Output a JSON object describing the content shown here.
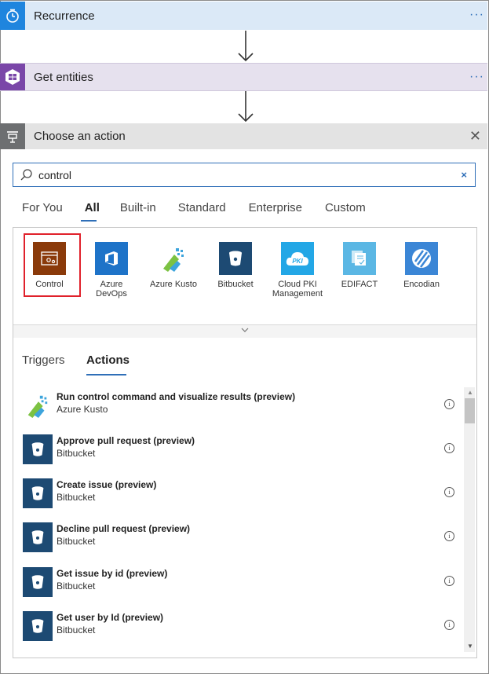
{
  "steps": {
    "recurrence": {
      "title": "Recurrence",
      "more": "···"
    },
    "get_entities": {
      "title": "Get entities",
      "more": "···"
    },
    "choose_action": {
      "title": "Choose an action",
      "close": "✕"
    }
  },
  "search": {
    "value": "control",
    "clear": "×"
  },
  "category_tabs": [
    "For You",
    "All",
    "Built-in",
    "Standard",
    "Enterprise",
    "Custom"
  ],
  "category_selected": "All",
  "connectors": [
    {
      "line1": "Control",
      "line2": "",
      "icon": "control-icon",
      "color": "#8a3a0a"
    },
    {
      "line1": "Azure",
      "line2": "DevOps",
      "icon": "azure-devops-icon",
      "color": "#1e73c8"
    },
    {
      "line1": "Azure Kusto",
      "line2": "",
      "icon": "azure-kusto-icon",
      "color": "#ffffff"
    },
    {
      "line1": "Bitbucket",
      "line2": "",
      "icon": "bitbucket-icon",
      "color": "#1d4a73"
    },
    {
      "line1": "Cloud PKI",
      "line2": "Management",
      "icon": "cloud-pki-icon",
      "color": "#23a7e6"
    },
    {
      "line1": "EDIFACT",
      "line2": "",
      "icon": "edifact-icon",
      "color": "#5bb7e4"
    },
    {
      "line1": "Encodian",
      "line2": "",
      "icon": "encodian-icon",
      "color": "#3b86d6"
    }
  ],
  "trigger_tabs": {
    "triggers": "Triggers",
    "actions": "Actions"
  },
  "actions": [
    {
      "name": "Run control command and visualize results (preview)",
      "connector": "Azure Kusto",
      "icon": "azure-kusto-icon"
    },
    {
      "name": "Approve pull request (preview)",
      "connector": "Bitbucket",
      "icon": "bitbucket-icon"
    },
    {
      "name": "Create issue (preview)",
      "connector": "Bitbucket",
      "icon": "bitbucket-icon"
    },
    {
      "name": "Decline pull request (preview)",
      "connector": "Bitbucket",
      "icon": "bitbucket-icon"
    },
    {
      "name": "Get issue by id (preview)",
      "connector": "Bitbucket",
      "icon": "bitbucket-icon"
    },
    {
      "name": "Get user by Id (preview)",
      "connector": "Bitbucket",
      "icon": "bitbucket-icon"
    }
  ],
  "info_glyph": "i",
  "colors": {
    "accent": "#2f6fb8",
    "selection": "#e0212b",
    "recurrence": "#1f85de",
    "entities": "#7a46a8",
    "action_header": "#6d6f71"
  }
}
